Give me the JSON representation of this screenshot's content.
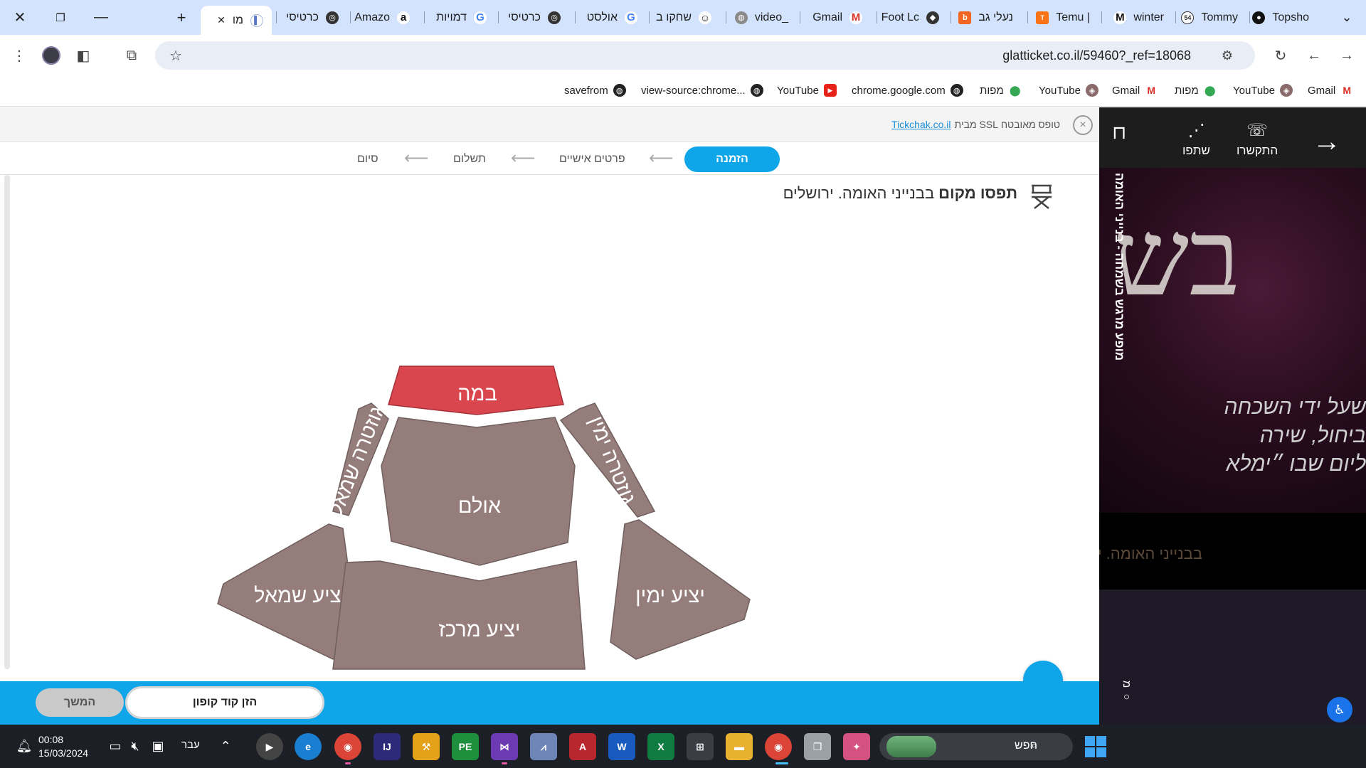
{
  "browser": {
    "tabs": [
      {
        "label": "מו",
        "active": true
      },
      {
        "label": "כרטיסי"
      },
      {
        "label": "Amazo"
      },
      {
        "label": "דמויות"
      },
      {
        "label": "כרטיסי"
      },
      {
        "label": "אולסט"
      },
      {
        "label": "שחקו ב"
      },
      {
        "label": "video_"
      },
      {
        "label": "Gmail"
      },
      {
        "label": "Foot Lc"
      },
      {
        "label": "נעלי גב"
      },
      {
        "label": "Temu |"
      },
      {
        "label": "winter"
      },
      {
        "label": "Tommy"
      },
      {
        "label": "Topsho"
      }
    ],
    "url": "glatticket.co.il/59460?_ref=18068",
    "bookmarks": [
      "Gmail",
      "YouTube",
      "מפות",
      "Gmail",
      "YouTube",
      "מפות",
      "chrome.google.com",
      "YouTube",
      "view-source:chrome...",
      "savefrom"
    ]
  },
  "ssl": {
    "text": "טופס מאובטח SSL מבית",
    "link": "Tickchak.co.il",
    "close": "×"
  },
  "steps": [
    {
      "label": "הזמנה",
      "active": true
    },
    {
      "label": "פרטים אישיים"
    },
    {
      "label": "תשלום"
    },
    {
      "label": "סיום"
    }
  ],
  "venue": {
    "prefix": "תפסו מקום",
    "name": "בבנייני האומה. ירושלים"
  },
  "sections": {
    "stage": "במה",
    "hall": "אולם",
    "balcony_left": "גוזטרה שמאל",
    "balcony_right": "גוזטרה ימין",
    "gallery_left": "יציע שמאל",
    "gallery_right": "יציע ימין",
    "gallery_center": "יציע מרכז"
  },
  "actions": {
    "continue": "המשך",
    "coupon": "הזן קוד קופון"
  },
  "sidebar": {
    "call": "התקשרו",
    "share": "שתפו",
    "event_title": "מופע מרגש בשמחה - בנייני האומה",
    "hero_big": "בש",
    "hero_lines": [
      "שעל ידי השכחה",
      "ביחול, שירה",
      "ליום שבו ״ימלא"
    ],
    "venue": "בבנייני האומה. י",
    "misc": "מ ○"
  },
  "taskbar": {
    "time": "00:08",
    "date": "15/03/2024",
    "lang": "עבר",
    "search": "חפש"
  },
  "colors": {
    "accent": "#0ea5e9",
    "stage": "#d9464e",
    "section": "#957d7b"
  }
}
